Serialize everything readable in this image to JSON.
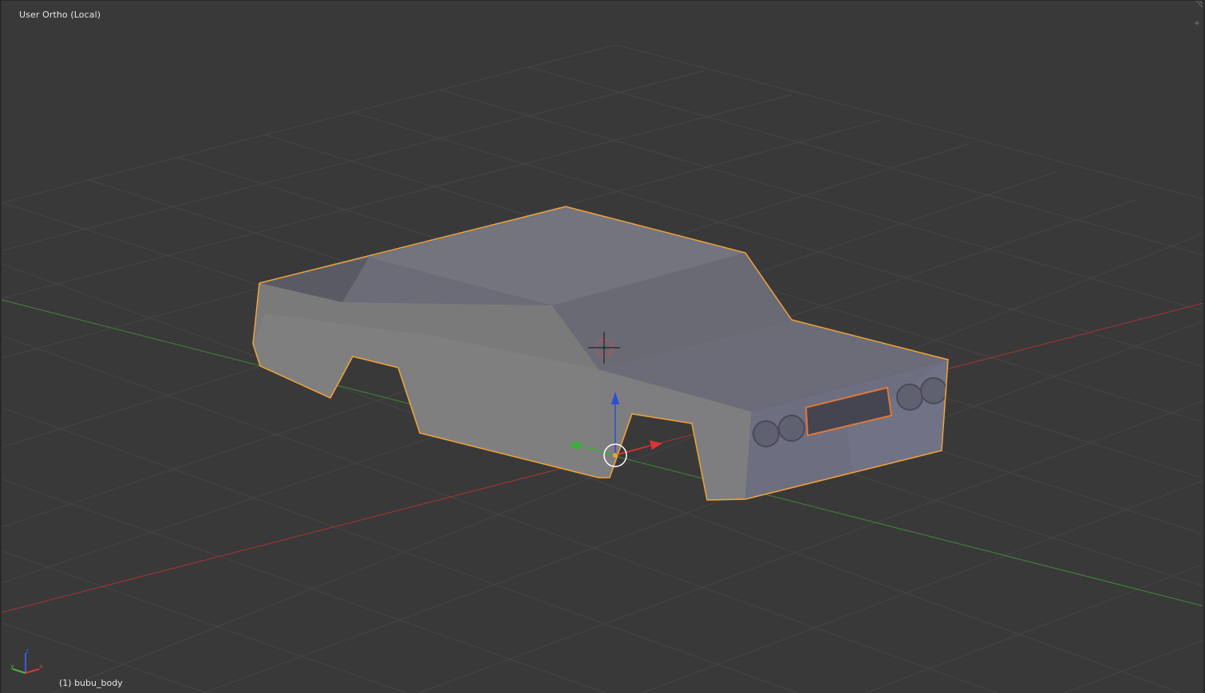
{
  "viewport": {
    "view_name": "User Ortho (Local)",
    "object_info": "(1) bubu_body",
    "background_color": "#393939"
  },
  "axes": {
    "x_color": "#d23a3a",
    "y_color": "#4fb241",
    "z_color": "#3a5bd6",
    "x_label": "x",
    "y_label": "y",
    "z_label": "z"
  },
  "selection": {
    "outline_color": "#f2a33a"
  },
  "icons": {
    "corner_plus": "+"
  }
}
